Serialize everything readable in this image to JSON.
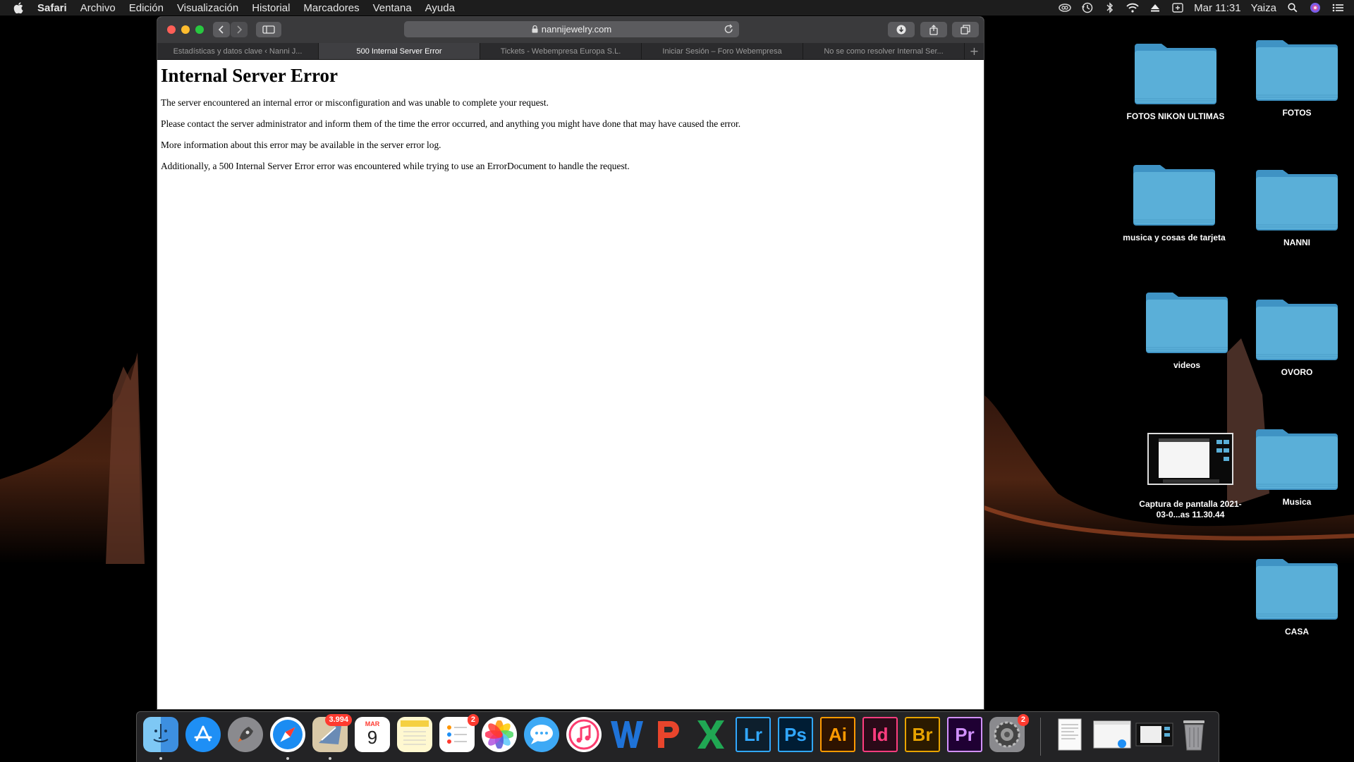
{
  "menubar": {
    "app_name": "Safari",
    "items": [
      "Archivo",
      "Edición",
      "Visualización",
      "Historial",
      "Marcadores",
      "Ventana",
      "Ayuda"
    ],
    "clock": "Mar 11:31",
    "user": "Yaiza"
  },
  "browser": {
    "url": "nannijewelry.com",
    "tabs": [
      {
        "label": "Estadísticas y datos clave ‹ Nanni J..."
      },
      {
        "label": "500 Internal Server Error"
      },
      {
        "label": "Tickets - Webempresa Europa S.L."
      },
      {
        "label": "Iniciar Sesión – Foro Webempresa"
      },
      {
        "label": "No se como resolver Internal Ser..."
      }
    ],
    "new_tab": "+"
  },
  "page": {
    "heading": "Internal Server Error",
    "paragraphs": [
      "The server encountered an internal error or misconfiguration and was unable to complete your request.",
      "Please contact the server administrator and inform them of the time the error occurred, and anything you might have done that may have caused the error.",
      "More information about this error may be available in the server error log.",
      "Additionally, a 500 Internal Server Error error was encountered while trying to use an ErrorDocument to handle the request."
    ]
  },
  "desktop": {
    "items": [
      {
        "label": "FOTOS NIKON ULTIMAS"
      },
      {
        "label": "FOTOS"
      },
      {
        "label": "musica y cosas de tarjeta"
      },
      {
        "label": "NANNI"
      },
      {
        "label": "videos"
      },
      {
        "label": "OVORO"
      },
      {
        "label": "Captura de pantalla 2021-03-0...as 11.30.44"
      },
      {
        "label": "Musica"
      },
      {
        "label": "CASA"
      }
    ]
  },
  "dock": {
    "mail_badge": "3.994",
    "reminders_badge": "2",
    "prefs_badge": "2",
    "calendar_month": "MAR",
    "calendar_day": "9",
    "apps": {
      "lr": "Lr",
      "ps": "Ps",
      "ai": "Ai",
      "id": "Id",
      "br": "Br",
      "pr": "Pr"
    }
  },
  "colors": {
    "folder": "#5aafd8",
    "menubar": "#1d1d1d",
    "toolbar": "#3a3a3c",
    "badge": "#ff3b30"
  }
}
